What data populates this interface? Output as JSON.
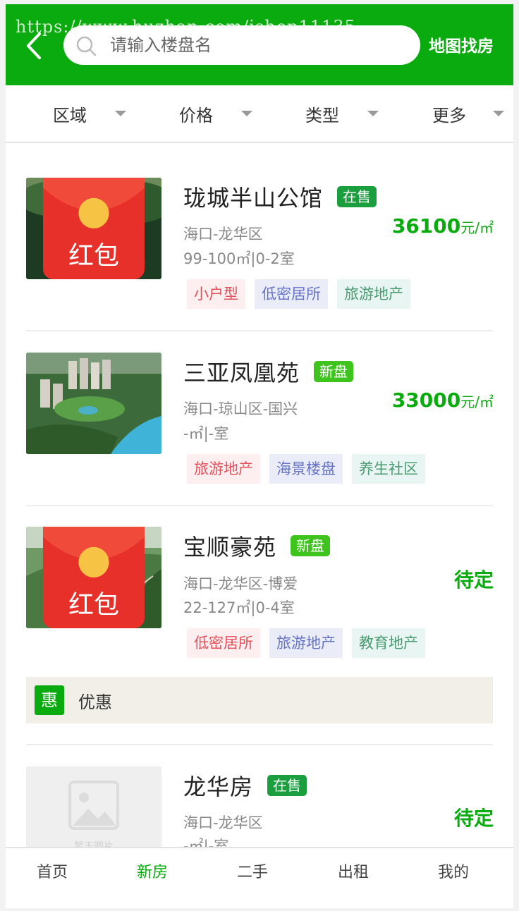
{
  "watermark": "https://www.huzhan.com/ishop11135",
  "header": {
    "search_placeholder": "请输入楼盘名",
    "map_label": "地图找房"
  },
  "filters": [
    "区域",
    "价格",
    "类型",
    "更多"
  ],
  "listings": [
    {
      "title": "珑城半山公馆",
      "status": "在售",
      "location": "海口-龙华区",
      "size": "99-100㎡|0-2室",
      "price": "36100",
      "unit": "元/㎡",
      "tags": [
        "小户型",
        "低密居所",
        "旅游地产"
      ],
      "has_redbag": true,
      "redbag_label": "红包"
    },
    {
      "title": "三亚凤凰苑",
      "status": "新盘",
      "location": "海口-琼山区-国兴",
      "size": "-㎡|-室",
      "price": "33000",
      "unit": "元/㎡",
      "tags": [
        "旅游地产",
        "海景楼盘",
        "养生社区"
      ],
      "has_redbag": false
    },
    {
      "title": "宝顺豪苑",
      "status": "新盘",
      "location": "海口-龙华区-博爱",
      "size": "22-127㎡|0-4室",
      "price": "待定",
      "unit": "",
      "tags": [
        "低密居所",
        "旅游地产",
        "教育地产"
      ],
      "has_redbag": true,
      "redbag_label": "红包",
      "promo": {
        "icon": "惠",
        "label": "优惠"
      }
    },
    {
      "title": "龙华房",
      "status": "在售",
      "location": "海口-龙华区",
      "size": "-㎡|-室",
      "price": "待定",
      "unit": "",
      "tags": [],
      "has_redbag": false,
      "placeholder_text": "暂无图片"
    }
  ],
  "tabs": [
    {
      "label": "首页",
      "active": false
    },
    {
      "label": "新房",
      "active": true
    },
    {
      "label": "二手",
      "active": false
    },
    {
      "label": "出租",
      "active": false
    },
    {
      "label": "我的",
      "active": false
    }
  ],
  "colors": {
    "brand_green": "#0aab0f",
    "badge_sale": "#1b9e3e",
    "badge_new": "#3ec41d",
    "tag_red": "#e2505a",
    "tag_blue": "#6673c4",
    "tag_teal": "#4a9a72"
  },
  "icons": [
    "back-arrow-icon",
    "search-icon",
    "caret-down-icon",
    "red-envelope-icon",
    "image-placeholder-icon"
  ]
}
